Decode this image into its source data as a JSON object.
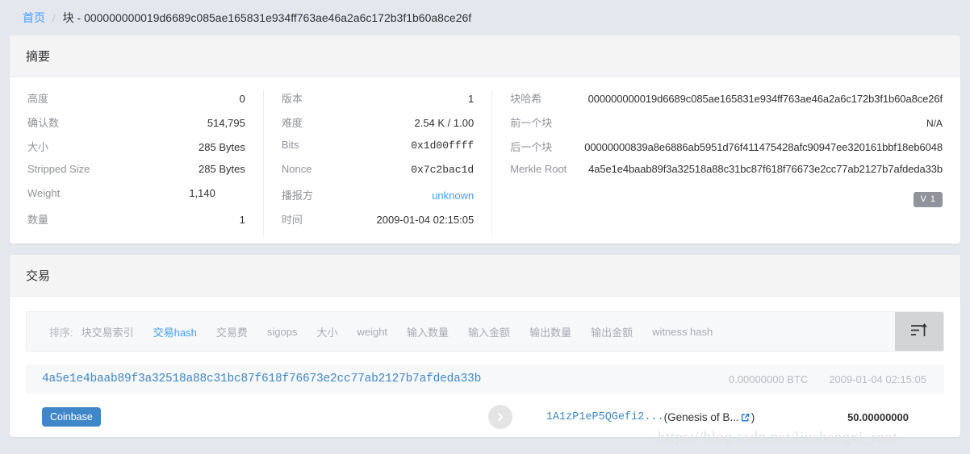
{
  "breadcrumb": {
    "home": "首页",
    "separator": "/",
    "current": "块 - 000000000019d6689c085ae165831e934ff763ae46a2a6c172b3f1b60a8ce26f"
  },
  "summary": {
    "title": "摘要",
    "col1": [
      {
        "key": "高度",
        "value": "0"
      },
      {
        "key": "确认数",
        "value": "514,795"
      },
      {
        "key": "大小",
        "value": "285 Bytes"
      },
      {
        "key": "Stripped Size",
        "value": "285 Bytes"
      },
      {
        "key": "Weight",
        "value": "1,140"
      },
      {
        "key": "数量",
        "value": "1"
      }
    ],
    "col2": [
      {
        "key": "版本",
        "value": "1"
      },
      {
        "key": "难度",
        "value": "2.54 K / 1.00"
      },
      {
        "key": "Bits",
        "value": "0x1d00ffff"
      },
      {
        "key": "Nonce",
        "value": "0x7c2bac1d"
      },
      {
        "key": "播报方",
        "value": "unknown"
      },
      {
        "key": "时间",
        "value": "2009-01-04 02:15:05"
      }
    ],
    "col3": [
      {
        "key": "块哈希",
        "value": "000000000019d6689c085ae165831e934ff763ae46a2a6c172b3f1b60a8ce26f"
      },
      {
        "key": "前一个块",
        "value": "N/A"
      },
      {
        "key": "后一个块",
        "value": "00000000839a8e6886ab5951d76f411475428afc90947ee320161bbf18eb6048"
      },
      {
        "key": "Merkle Root",
        "value": "4a5e1e4baab89f3a32518a88c31bc87f618f76673e2cc77ab2127b7afdeda33b"
      }
    ],
    "version_badge": "V 1"
  },
  "transactions": {
    "title": "交易",
    "sort_label": "排序:",
    "sort_items": [
      "块交易索引",
      "交易hash",
      "交易费",
      "sigops",
      "大小",
      "weight",
      "输入数量",
      "输入金额",
      "输出数量",
      "输出金额",
      "witness hash"
    ],
    "sort_active": "交易hash",
    "sort_button_icon": "sort-ascending-icon",
    "rows": [
      {
        "hash": "4a5e1e4baab89f3a32518a88c31bc87f618f76673e2cc77ab2127b7afdeda33b",
        "fee": "0.00000000 BTC",
        "time": "2009-01-04 02:15:05",
        "input_badge": "Coinbase",
        "arrow_icon": "chevron-right-icon",
        "output_address": "1A1zP1eP5QGefi2...",
        "output_label_open": "(Genesis of B...",
        "output_label_close": ")",
        "output_external_icon": "external-link-icon",
        "output_amount": "50.00000000"
      }
    ]
  },
  "watermark": "https://blog.csdn.net/liushengxi_root",
  "colors": {
    "page_bg": "#e4e7ed",
    "link": "#409eff",
    "badge_gray": "#909399",
    "coinbase_blue": "#3f87c9"
  }
}
